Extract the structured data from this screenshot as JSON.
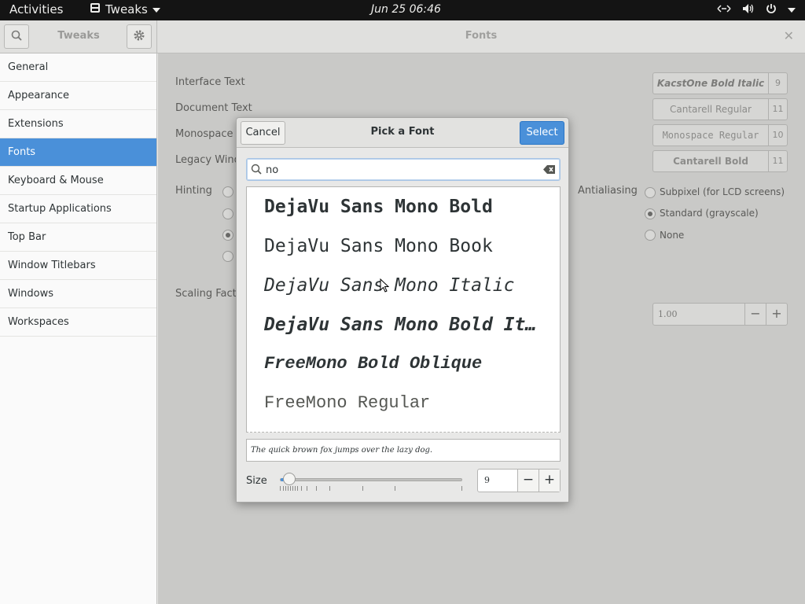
{
  "topbar": {
    "activities": "Activities",
    "app_name": "Tweaks",
    "clock": "Jun 25  06:46"
  },
  "header": {
    "sidebar_title": "Tweaks",
    "title": "Fonts"
  },
  "sidebar": {
    "items": [
      {
        "label": "General"
      },
      {
        "label": "Appearance"
      },
      {
        "label": "Extensions"
      },
      {
        "label": "Fonts"
      },
      {
        "label": "Keyboard & Mouse"
      },
      {
        "label": "Startup Applications"
      },
      {
        "label": "Top Bar"
      },
      {
        "label": "Window Titlebars"
      },
      {
        "label": "Windows"
      },
      {
        "label": "Workspaces"
      }
    ],
    "active_index": 3
  },
  "fonts": {
    "interface_text_label": "Interface Text",
    "interface_text_font": "KacstOne Bold Italic",
    "interface_text_size": "9",
    "document_text_label": "Document Text",
    "document_text_font": "Cantarell Regular",
    "document_text_size": "11",
    "monospace_text_label": "Monospace T",
    "monospace_text_font": "Monospace Regular",
    "monospace_text_size": "10",
    "legacy_label": "Legacy Wind",
    "legacy_font": "Cantarell Bold",
    "legacy_size": "11",
    "hinting_label": "Hinting",
    "antialiasing_label": "Antialiasing",
    "antialiasing_options": [
      "Subpixel (for LCD screens)",
      "Standard (grayscale)",
      "None"
    ],
    "antialiasing_selected": "Standard (grayscale)",
    "scaling_label": "Scaling Facto",
    "scaling_value": "1.00",
    "minus": "−",
    "plus": "+"
  },
  "dialog": {
    "title": "Pick a Font",
    "cancel": "Cancel",
    "select": "Select",
    "search_value": "no",
    "font_items": [
      "DejaVu Sans Mono Bold",
      "DejaVu Sans Mono Book",
      "DejaVu Sans Mono Italic",
      "DejaVu Sans Mono Bold Italic",
      "FreeMono Bold Oblique",
      "FreeMono Regular"
    ],
    "preview_text": "The quick brown fox jumps over the lazy dog.",
    "size_label": "Size",
    "size_value": "9",
    "size_slider_fraction": 0.05,
    "minus": "−",
    "plus": "+"
  },
  "colors": {
    "accent": "#4a90d9",
    "topbar": "#141414"
  }
}
